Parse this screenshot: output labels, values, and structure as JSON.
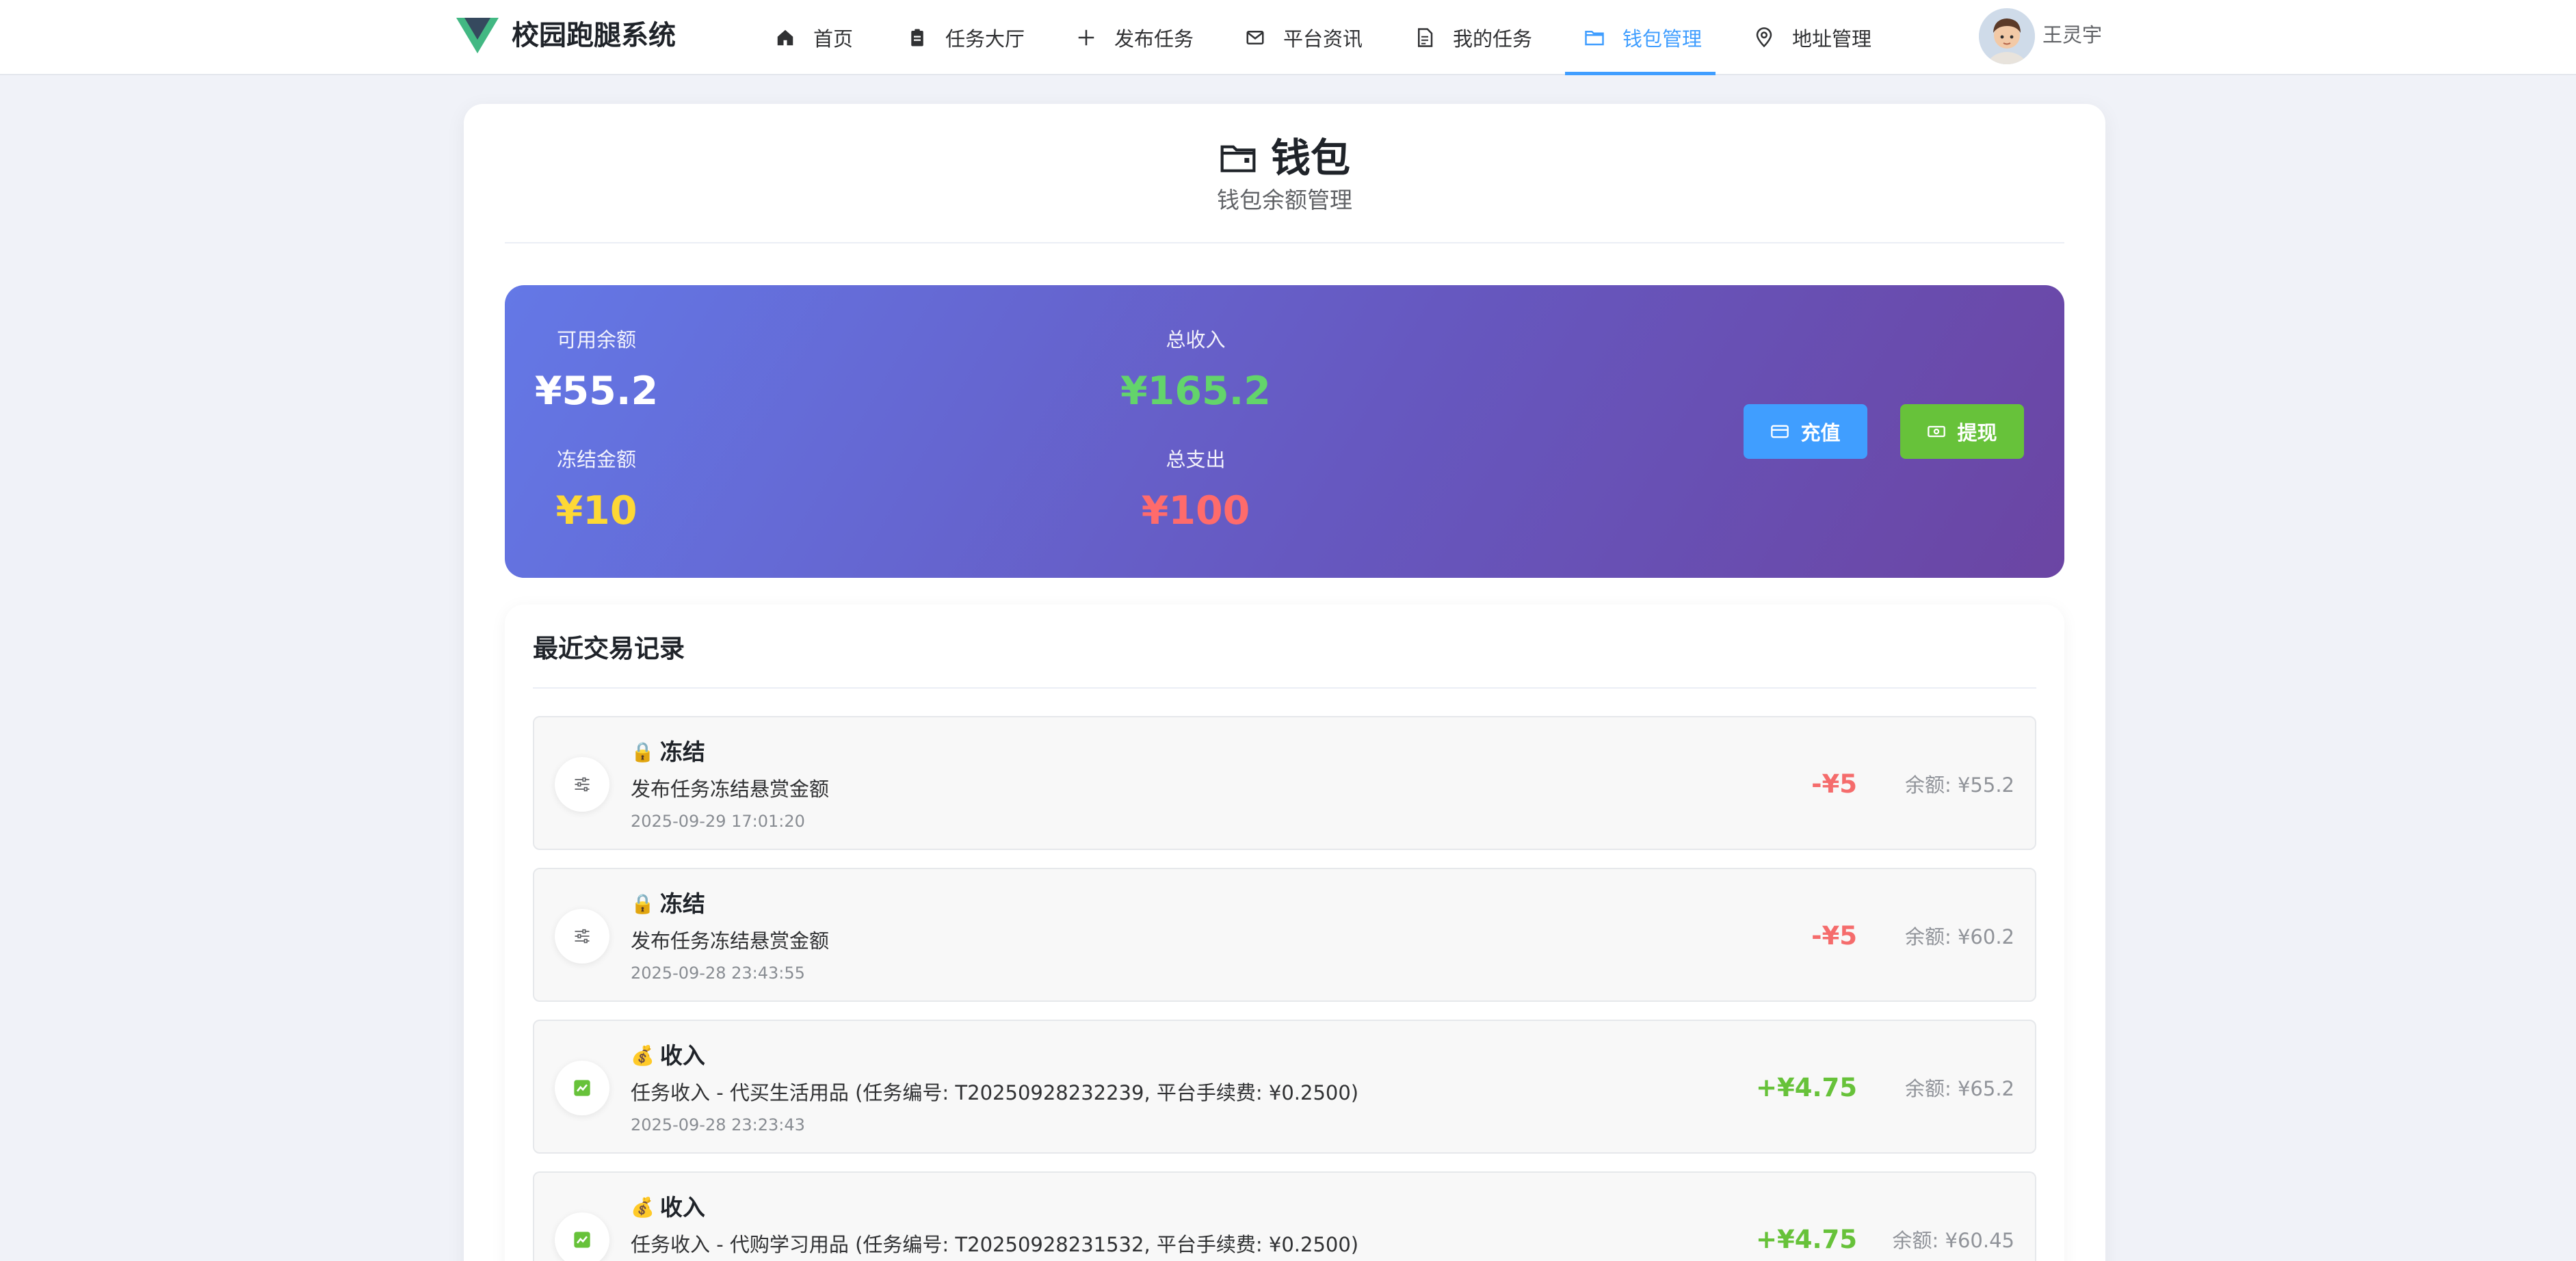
{
  "app": {
    "brand": "校园跑腿系统",
    "logo_icon": "vue-logo-icon"
  },
  "nav": {
    "items": [
      {
        "label": "首页",
        "icon": "home-icon",
        "active": false
      },
      {
        "label": "任务大厅",
        "icon": "clipboard-icon",
        "active": false
      },
      {
        "label": "发布任务",
        "icon": "plus-icon",
        "active": false
      },
      {
        "label": "平台资讯",
        "icon": "message-icon",
        "active": false
      },
      {
        "label": "我的任务",
        "icon": "document-icon",
        "active": false
      },
      {
        "label": "钱包管理",
        "icon": "wallet-icon",
        "active": true
      },
      {
        "label": "地址管理",
        "icon": "location-icon",
        "active": false
      }
    ],
    "user": {
      "name": "王灵宇",
      "avatar_icon": "avatar"
    }
  },
  "page": {
    "title": "钱包",
    "subtitle": "钱包余额管理",
    "title_icon": "wallet-icon"
  },
  "wallet": {
    "available": {
      "label": "可用余额",
      "value": "¥55.2"
    },
    "frozen": {
      "label": "冻结金额",
      "value": "¥10"
    },
    "income": {
      "label": "总收入",
      "value": "¥165.2"
    },
    "expense": {
      "label": "总支出",
      "value": "¥100"
    },
    "recharge_label": "充值",
    "withdraw_label": "提现"
  },
  "colors": {
    "accent": "#409eff",
    "success": "#67c23a",
    "danger": "#f56c6c",
    "income_value": "#63d46b",
    "frozen_value": "#fdd835",
    "expense_value": "#ff6b6b",
    "banner_start": "#6478e6",
    "banner_end": "#6b45a3"
  },
  "transactions": {
    "title": "最近交易记录",
    "items": [
      {
        "type": "冻结",
        "emoji": "🔒",
        "icon": "sliders-icon",
        "desc": "发布任务冻结悬赏金额",
        "time": "2025-09-29 17:01:20",
        "amount": "-¥5",
        "balance": "余额: ¥55.2"
      },
      {
        "type": "冻结",
        "emoji": "🔒",
        "icon": "sliders-icon",
        "desc": "发布任务冻结悬赏金额",
        "time": "2025-09-28 23:43:55",
        "amount": "-¥5",
        "balance": "余额: ¥60.2"
      },
      {
        "type": "收入",
        "emoji": "💰",
        "icon": "trend-up-icon",
        "desc": "任务收入 - 代买生活用品 (任务编号: T20250928232239, 平台手续费: ¥0.2500)",
        "time": "2025-09-28 23:23:43",
        "amount": "+¥4.75",
        "balance": "余额: ¥65.2"
      },
      {
        "type": "收入",
        "emoji": "💰",
        "icon": "trend-up-icon",
        "desc": "任务收入 - 代购学习用品 (任务编号: T20250928231532, 平台手续费: ¥0.2500)",
        "time": "",
        "amount": "+¥4.75",
        "balance": "余额: ¥60.45"
      }
    ]
  }
}
